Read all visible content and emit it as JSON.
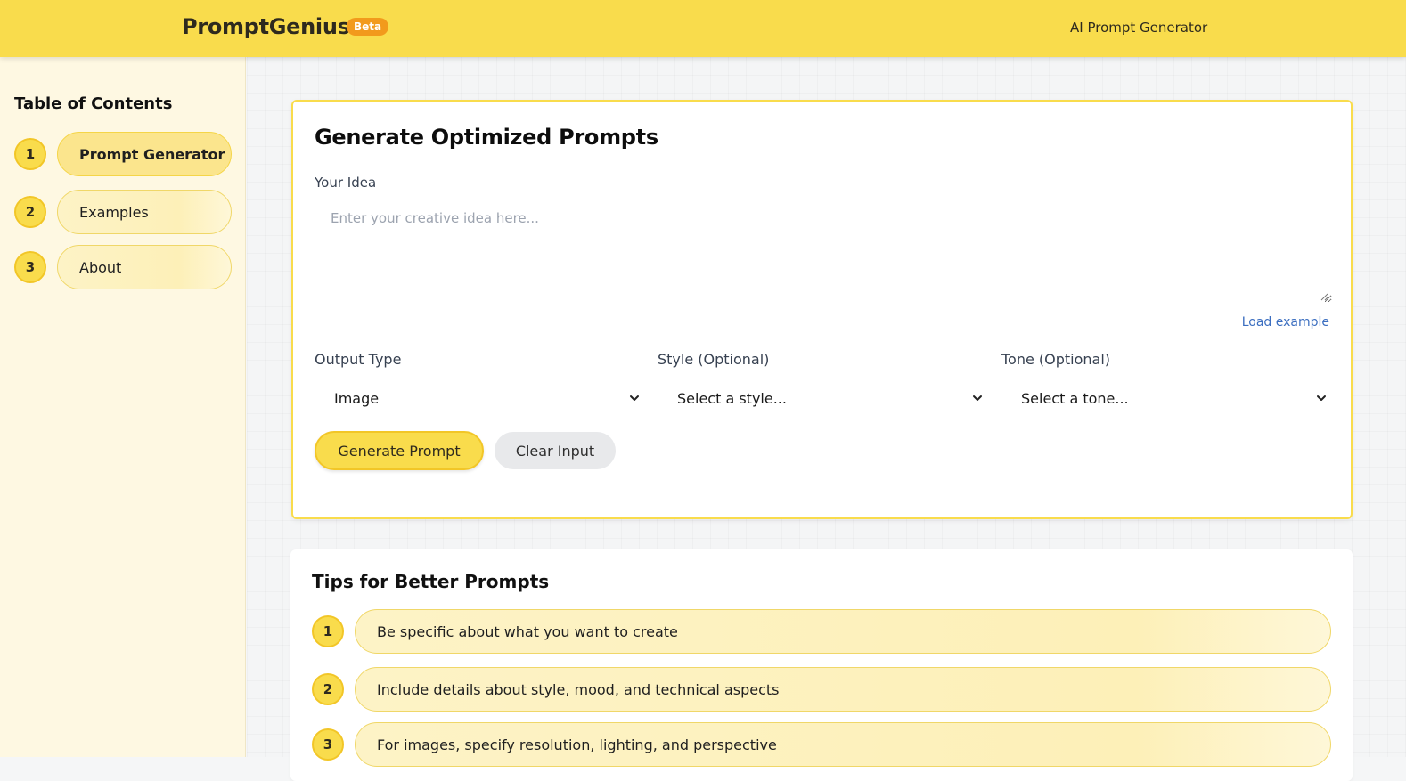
{
  "header": {
    "brand": "PromptGenius",
    "badge": "Beta",
    "right_text": "AI Prompt Generator"
  },
  "sidebar": {
    "title": "Table of Contents",
    "items": [
      {
        "num": "1",
        "label": "Prompt Generator",
        "active": true
      },
      {
        "num": "2",
        "label": "Examples",
        "active": false
      },
      {
        "num": "3",
        "label": "About",
        "active": false
      }
    ]
  },
  "generator": {
    "title": "Generate Optimized Prompts",
    "idea_label": "Your Idea",
    "idea_placeholder": "Enter your creative idea here...",
    "idea_value": "",
    "load_example": "Load example",
    "output_type_label": "Output Type",
    "output_type_value": "Image",
    "style_label": "Style (Optional)",
    "style_value": "Select a style...",
    "tone_label": "Tone (Optional)",
    "tone_value": "Select a tone...",
    "generate_button": "Generate Prompt",
    "clear_button": "Clear Input"
  },
  "tips": {
    "title": "Tips for Better Prompts",
    "items": [
      {
        "num": "1",
        "text": "Be specific about what you want to create"
      },
      {
        "num": "2",
        "text": "Include details about style, mood, and technical aspects"
      },
      {
        "num": "3",
        "text": "For images, specify resolution, lighting, and perspective"
      }
    ]
  },
  "colors": {
    "primary_yellow": "#f9dc4c",
    "badge_orange": "#f29a1c",
    "link_blue": "#3b6ec0",
    "sidebar_bg": "#fef8e2"
  },
  "icons": {
    "select_arrow": "chevron-down-icon",
    "textarea_resize": "resize-grip-icon"
  }
}
